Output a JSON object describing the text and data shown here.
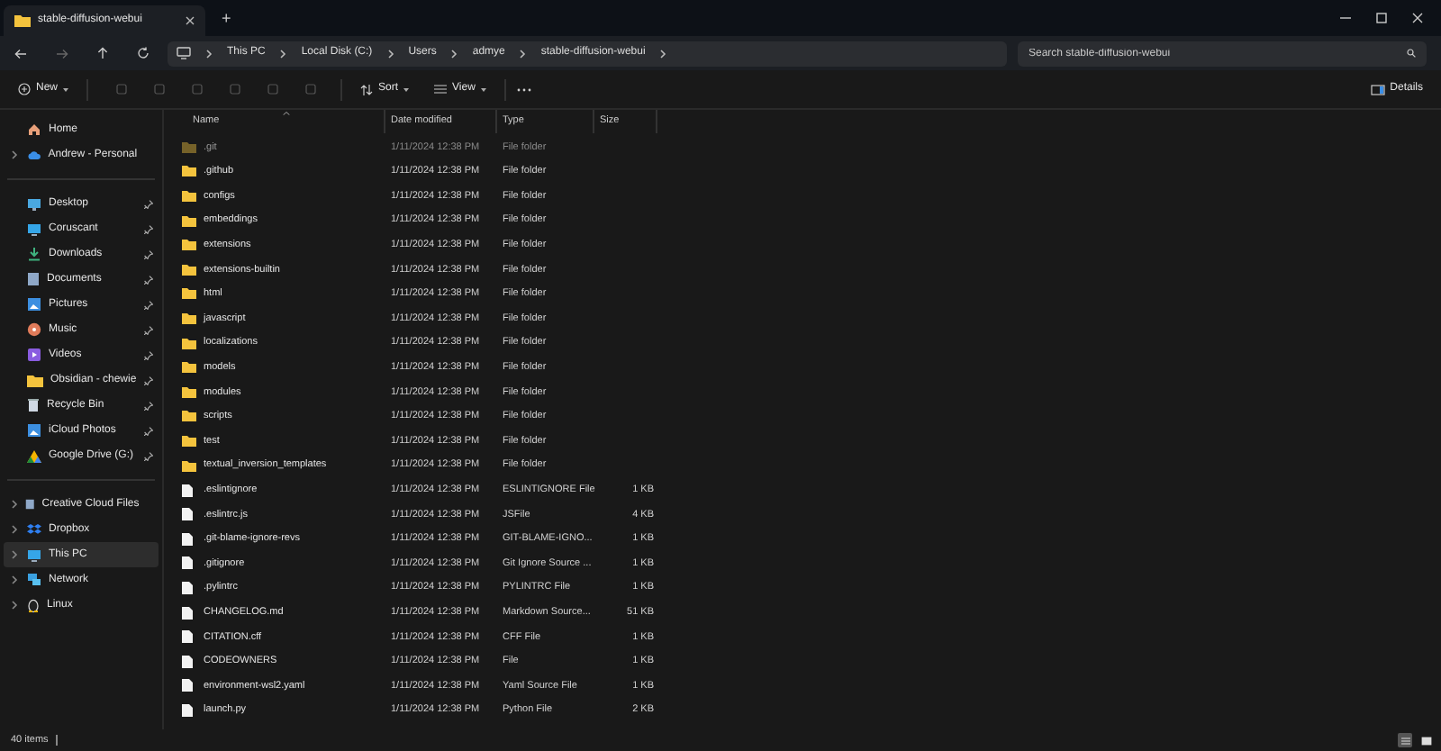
{
  "window": {
    "tab_title": "stable-diffusion-webui",
    "new_tab": "+"
  },
  "address": {
    "crumbs": [
      "This PC",
      "Local Disk (C:)",
      "Users",
      "admye",
      "stable-diffusion-webui"
    ]
  },
  "search": {
    "placeholder": "Search stable-diffusion-webui"
  },
  "toolbar": {
    "new": "New",
    "sort": "Sort",
    "view": "View",
    "details": "Details"
  },
  "sidebar": {
    "groups": [
      [
        {
          "label": "Home",
          "expandable": false,
          "pinned": false,
          "selected": false
        },
        {
          "label": "Andrew - Personal",
          "expandable": true,
          "pinned": false,
          "selected": false
        }
      ],
      [
        {
          "label": "Desktop",
          "expandable": false,
          "pinned": true,
          "selected": false
        },
        {
          "label": "Coruscant",
          "expandable": false,
          "pinned": true,
          "selected": false
        },
        {
          "label": "Downloads",
          "expandable": false,
          "pinned": true,
          "selected": false
        },
        {
          "label": "Documents",
          "expandable": false,
          "pinned": true,
          "selected": false
        },
        {
          "label": "Pictures",
          "expandable": false,
          "pinned": true,
          "selected": false
        },
        {
          "label": "Music",
          "expandable": false,
          "pinned": true,
          "selected": false
        },
        {
          "label": "Videos",
          "expandable": false,
          "pinned": true,
          "selected": false
        },
        {
          "label": "Obsidian - chewie",
          "expandable": false,
          "pinned": true,
          "selected": false
        },
        {
          "label": "Recycle Bin",
          "expandable": false,
          "pinned": true,
          "selected": false
        },
        {
          "label": "iCloud Photos",
          "expandable": false,
          "pinned": true,
          "selected": false
        },
        {
          "label": "Google Drive (G:)",
          "expandable": false,
          "pinned": true,
          "selected": false
        }
      ],
      [
        {
          "label": "Creative Cloud Files",
          "expandable": true,
          "pinned": false,
          "selected": false
        },
        {
          "label": "Dropbox",
          "expandable": true,
          "pinned": false,
          "selected": false
        },
        {
          "label": "This PC",
          "expandable": true,
          "pinned": false,
          "selected": true
        },
        {
          "label": "Network",
          "expandable": true,
          "pinned": false,
          "selected": false
        },
        {
          "label": "Linux",
          "expandable": true,
          "pinned": false,
          "selected": false
        }
      ]
    ]
  },
  "table": {
    "columns": [
      "Name",
      "Date modified",
      "Type",
      "Size"
    ],
    "rows": [
      {
        "kind": "folder",
        "hidden": true,
        "name": ".git",
        "date": "1/11/2024 12:38 PM",
        "type": "File folder"
      },
      {
        "kind": "folder",
        "hidden": false,
        "name": ".github",
        "date": "1/11/2024 12:38 PM",
        "type": "File folder"
      },
      {
        "kind": "folder",
        "hidden": false,
        "name": "configs",
        "date": "1/11/2024 12:38 PM",
        "type": "File folder"
      },
      {
        "kind": "folder",
        "hidden": false,
        "name": "embeddings",
        "date": "1/11/2024 12:38 PM",
        "type": "File folder"
      },
      {
        "kind": "folder",
        "hidden": false,
        "name": "extensions",
        "date": "1/11/2024 12:38 PM",
        "type": "File folder"
      },
      {
        "kind": "folder",
        "hidden": false,
        "name": "extensions-builtin",
        "date": "1/11/2024 12:38 PM",
        "type": "File folder"
      },
      {
        "kind": "folder",
        "hidden": false,
        "name": "html",
        "date": "1/11/2024 12:38 PM",
        "type": "File folder"
      },
      {
        "kind": "folder",
        "hidden": false,
        "name": "javascript",
        "date": "1/11/2024 12:38 PM",
        "type": "File folder"
      },
      {
        "kind": "folder",
        "hidden": false,
        "name": "localizations",
        "date": "1/11/2024 12:38 PM",
        "type": "File folder"
      },
      {
        "kind": "folder",
        "hidden": false,
        "name": "models",
        "date": "1/11/2024 12:38 PM",
        "type": "File folder"
      },
      {
        "kind": "folder",
        "hidden": false,
        "name": "modules",
        "date": "1/11/2024 12:38 PM",
        "type": "File folder"
      },
      {
        "kind": "folder",
        "hidden": false,
        "name": "scripts",
        "date": "1/11/2024 12:38 PM",
        "type": "File folder"
      },
      {
        "kind": "folder",
        "hidden": false,
        "name": "test",
        "date": "1/11/2024 12:38 PM",
        "type": "File folder"
      },
      {
        "kind": "folder",
        "hidden": false,
        "name": "textual_inversion_templates",
        "date": "1/11/2024 12:38 PM",
        "type": "File folder"
      },
      {
        "kind": "file",
        "hidden": false,
        "name": ".eslintignore",
        "date": "1/11/2024 12:38 PM",
        "type": "ESLINTIGNORE File",
        "size": "1 KB"
      },
      {
        "kind": "file",
        "hidden": false,
        "name": ".eslintrc.js",
        "date": "1/11/2024 12:38 PM",
        "type": "JSFile",
        "size": "4 KB"
      },
      {
        "kind": "file",
        "hidden": false,
        "name": ".git-blame-ignore-revs",
        "date": "1/11/2024 12:38 PM",
        "type": "GIT-BLAME-IGNO...",
        "size": "1 KB"
      },
      {
        "kind": "file",
        "hidden": false,
        "name": ".gitignore",
        "date": "1/11/2024 12:38 PM",
        "type": "Git Ignore Source ...",
        "size": "1 KB"
      },
      {
        "kind": "file",
        "hidden": false,
        "name": ".pylintrc",
        "date": "1/11/2024 12:38 PM",
        "type": "PYLINTRC File",
        "size": "1 KB"
      },
      {
        "kind": "file",
        "hidden": false,
        "name": "CHANGELOG.md",
        "date": "1/11/2024 12:38 PM",
        "type": "Markdown Source...",
        "size": "51 KB"
      },
      {
        "kind": "file",
        "hidden": false,
        "name": "CITATION.cff",
        "date": "1/11/2024 12:38 PM",
        "type": "CFF File",
        "size": "1 KB"
      },
      {
        "kind": "file",
        "hidden": false,
        "name": "CODEOWNERS",
        "date": "1/11/2024 12:38 PM",
        "type": "File",
        "size": "1 KB"
      },
      {
        "kind": "file",
        "hidden": false,
        "name": "environment-wsl2.yaml",
        "date": "1/11/2024 12:38 PM",
        "type": "Yaml Source File",
        "size": "1 KB"
      },
      {
        "kind": "file",
        "hidden": false,
        "name": "launch.py",
        "date": "1/11/2024 12:38 PM",
        "type": "Python File",
        "size": "2 KB"
      }
    ]
  },
  "status_bar": {
    "count": "40 items"
  }
}
